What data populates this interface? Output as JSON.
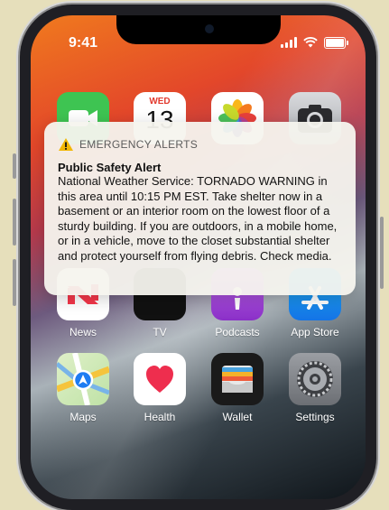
{
  "status_bar": {
    "time": "9:41"
  },
  "calendar_icon": {
    "weekday": "WED",
    "day": "13"
  },
  "alert": {
    "app": "EMERGENCY ALERTS",
    "title": "Public Safety Alert",
    "body": "National Weather Service: TORNADO WARNING in this area until 10:15 PM EST. Take shelter now in a basement or an interior room on the lowest floor of a sturdy building. If you are outdoors, in a mobile home, or in a vehicle, move to the closet substantial shelter and protect yourself from flying debris. Check media."
  },
  "apps": {
    "news": "News",
    "tv": "TV",
    "podcasts": "Podcasts",
    "app_store": "App Store",
    "maps": "Maps",
    "health": "Health",
    "wallet": "Wallet",
    "settings": "Settings"
  },
  "colors": {
    "background": "#e6dfbb",
    "alert_warning": "#f2b705",
    "facetime": "#3ec452",
    "health_heart": "#ee2e4e"
  }
}
